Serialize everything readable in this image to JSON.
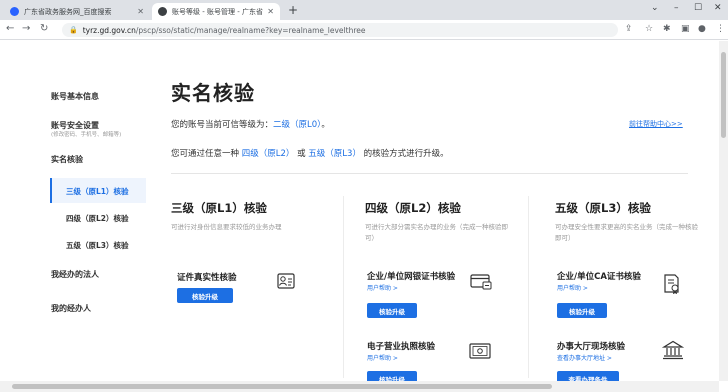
{
  "browser": {
    "tabs": [
      {
        "title": "广东省政务服务网_百度搜索",
        "close": "✕"
      },
      {
        "title": "账号等级 - 账号管理 - 广东省统",
        "close": "✕"
      }
    ],
    "new_tab": "+",
    "url_host": "tyrz.gd.gov.cn",
    "url_path": "/pscp/sso/static/manage/realname?key=realname_levelthree"
  },
  "sidebar": {
    "account_info": "账号基本信息",
    "security": "账号安全设置",
    "security_sub": "(修改密码、手机号、邮箱等)",
    "verify": "实名核验",
    "children": [
      "三级（原L1）核验",
      "四级（原L2）核验",
      "五级（原L3）核验"
    ],
    "my_legal": "我经办的法人",
    "my_agent": "我的经办人"
  },
  "main": {
    "title": "实名核验",
    "line1_pre": "您的账号当前可信等级为：",
    "line1_level": "二级（原L0）",
    "line1_post": "。",
    "help": "前往帮助中心>>",
    "line2_pre": "您可通过任意一种",
    "line2_a": "四级（原L2）",
    "line2_or": "或",
    "line2_b": "五级（原L3）",
    "line2_post": "的核验方式进行升级。",
    "columns": [
      {
        "title": "三级（原L1）核验",
        "desc": "可进行对身份信息要求较低的业务办理",
        "methods": [
          {
            "name": "证件真实性核验",
            "button": "核验升级"
          }
        ]
      },
      {
        "title": "四级（原L2）核验",
        "desc": "可进行大部分需实名办理的业务（完成一种核验即可）",
        "methods": [
          {
            "name": "企业/单位网银证书核验",
            "link": "用户帮助 >",
            "button": "核验升级"
          },
          {
            "name": "电子营业执照核验",
            "link": "用户帮助 >",
            "button": "核验升级"
          }
        ]
      },
      {
        "title": "五级（原L3）核验",
        "desc": "可办理安全性要求更高的实名业务（完成一种核验即可）",
        "methods": [
          {
            "name": "企业/单位CA证书核验",
            "link": "用户帮助 >",
            "button": "核验升级"
          },
          {
            "name": "办事大厅现场核验",
            "link": "查看办事大厅地址 >",
            "button": "查看办理条件"
          }
        ]
      }
    ]
  },
  "colors": {
    "accent": "#1d6fe3"
  }
}
